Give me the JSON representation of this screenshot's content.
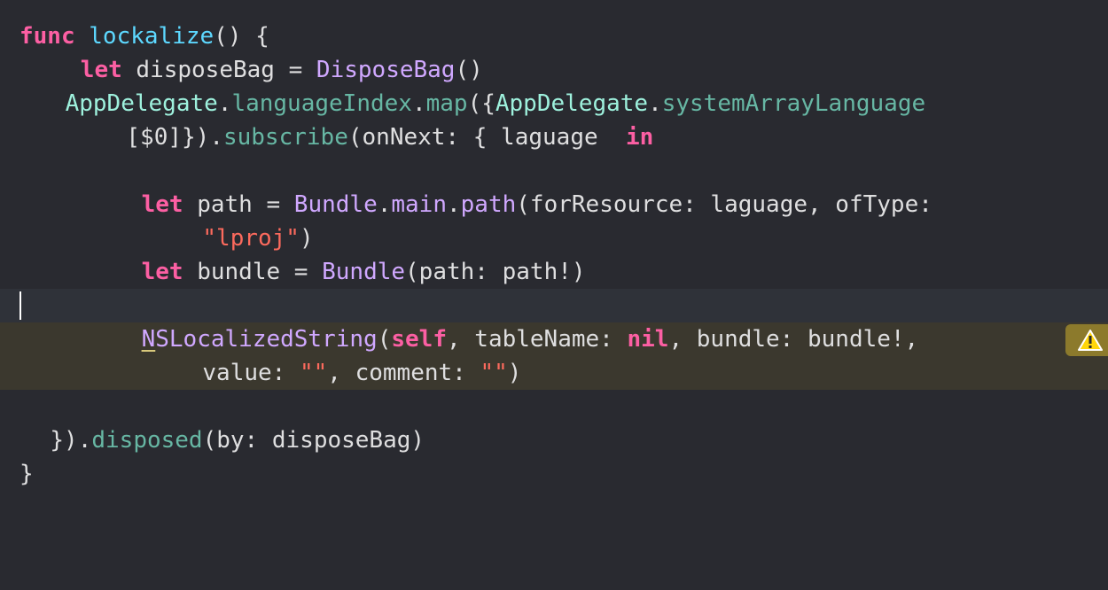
{
  "editor": {
    "warning_icon": "warning-triangle-icon",
    "colors": {
      "background": "#292a30",
      "keyword": "#fc5fa3",
      "function": "#67b7a4",
      "declaration": "#5dd8ff",
      "type": "#d0a8ff",
      "class": "#9ef1dd",
      "string": "#fc6a5d",
      "warning_line": "#3b382e",
      "warning_badge": "#8c7a2c"
    },
    "lines": [
      {
        "indent": 0,
        "tokens": [
          {
            "t": "func",
            "c": "kw"
          },
          {
            "t": " ",
            "c": "plain"
          },
          {
            "t": "lockalize",
            "c": "decl"
          },
          {
            "t": "() {",
            "c": "plain"
          }
        ]
      },
      {
        "indent": 4,
        "tokens": [
          {
            "t": "let",
            "c": "kw"
          },
          {
            "t": " disposeBag = ",
            "c": "plain"
          },
          {
            "t": "DisposeBag",
            "c": "type"
          },
          {
            "t": "()",
            "c": "plain"
          }
        ]
      },
      {
        "indent": 3,
        "tokens": [
          {
            "t": "AppDelegate",
            "c": "cls"
          },
          {
            "t": ".",
            "c": "plain"
          },
          {
            "t": "languageIndex",
            "c": "fn"
          },
          {
            "t": ".",
            "c": "plain"
          },
          {
            "t": "map",
            "c": "fn"
          },
          {
            "t": "({",
            "c": "plain"
          },
          {
            "t": "AppDelegate",
            "c": "cls"
          },
          {
            "t": ".",
            "c": "plain"
          },
          {
            "t": "systemArrayLanguage",
            "c": "fn"
          }
        ]
      },
      {
        "indent": 7,
        "tokens": [
          {
            "t": "[$0]})",
            "c": "plain"
          },
          {
            "t": ".",
            "c": "plain"
          },
          {
            "t": "subscribe",
            "c": "fn"
          },
          {
            "t": "(onNext: { laguage  ",
            "c": "plain"
          },
          {
            "t": "in",
            "c": "kw"
          }
        ]
      },
      {
        "indent": 0,
        "tokens": []
      },
      {
        "indent": 8,
        "tokens": [
          {
            "t": "let",
            "c": "kw"
          },
          {
            "t": " path = ",
            "c": "plain"
          },
          {
            "t": "Bundle",
            "c": "type"
          },
          {
            "t": ".",
            "c": "plain"
          },
          {
            "t": "main",
            "c": "type"
          },
          {
            "t": ".",
            "c": "plain"
          },
          {
            "t": "path",
            "c": "type"
          },
          {
            "t": "(forResource: laguage, ofType:",
            "c": "plain"
          }
        ]
      },
      {
        "indent": 12,
        "tokens": [
          {
            "t": "\"lproj\"",
            "c": "str"
          },
          {
            "t": ")",
            "c": "plain"
          }
        ]
      },
      {
        "indent": 8,
        "tokens": [
          {
            "t": "let",
            "c": "kw"
          },
          {
            "t": " bundle = ",
            "c": "plain"
          },
          {
            "t": "Bundle",
            "c": "type"
          },
          {
            "t": "(path: path!)",
            "c": "plain"
          }
        ]
      },
      {
        "indent": 0,
        "tokens": []
      },
      {
        "indent": 8,
        "tokens": [
          {
            "t": "N",
            "c": "type ul"
          },
          {
            "t": "SLocalizedString",
            "c": "type"
          },
          {
            "t": "(",
            "c": "plain"
          },
          {
            "t": "self",
            "c": "kw"
          },
          {
            "t": ", tableName: ",
            "c": "plain"
          },
          {
            "t": "nil",
            "c": "kw"
          },
          {
            "t": ", bundle: bundle!,",
            "c": "plain"
          }
        ]
      },
      {
        "indent": 12,
        "tokens": [
          {
            "t": "value: ",
            "c": "plain"
          },
          {
            "t": "\"\"",
            "c": "str"
          },
          {
            "t": ", comment: ",
            "c": "plain"
          },
          {
            "t": "\"\"",
            "c": "str"
          },
          {
            "t": ")",
            "c": "plain"
          }
        ]
      },
      {
        "indent": 0,
        "tokens": []
      },
      {
        "indent": 2,
        "tokens": [
          {
            "t": "})",
            "c": "plain"
          },
          {
            "t": ".",
            "c": "plain"
          },
          {
            "t": "disposed",
            "c": "fn"
          },
          {
            "t": "(by: disposeBag)",
            "c": "plain"
          }
        ]
      },
      {
        "indent": 0,
        "tokens": [
          {
            "t": "}",
            "c": "plain"
          }
        ]
      }
    ]
  }
}
